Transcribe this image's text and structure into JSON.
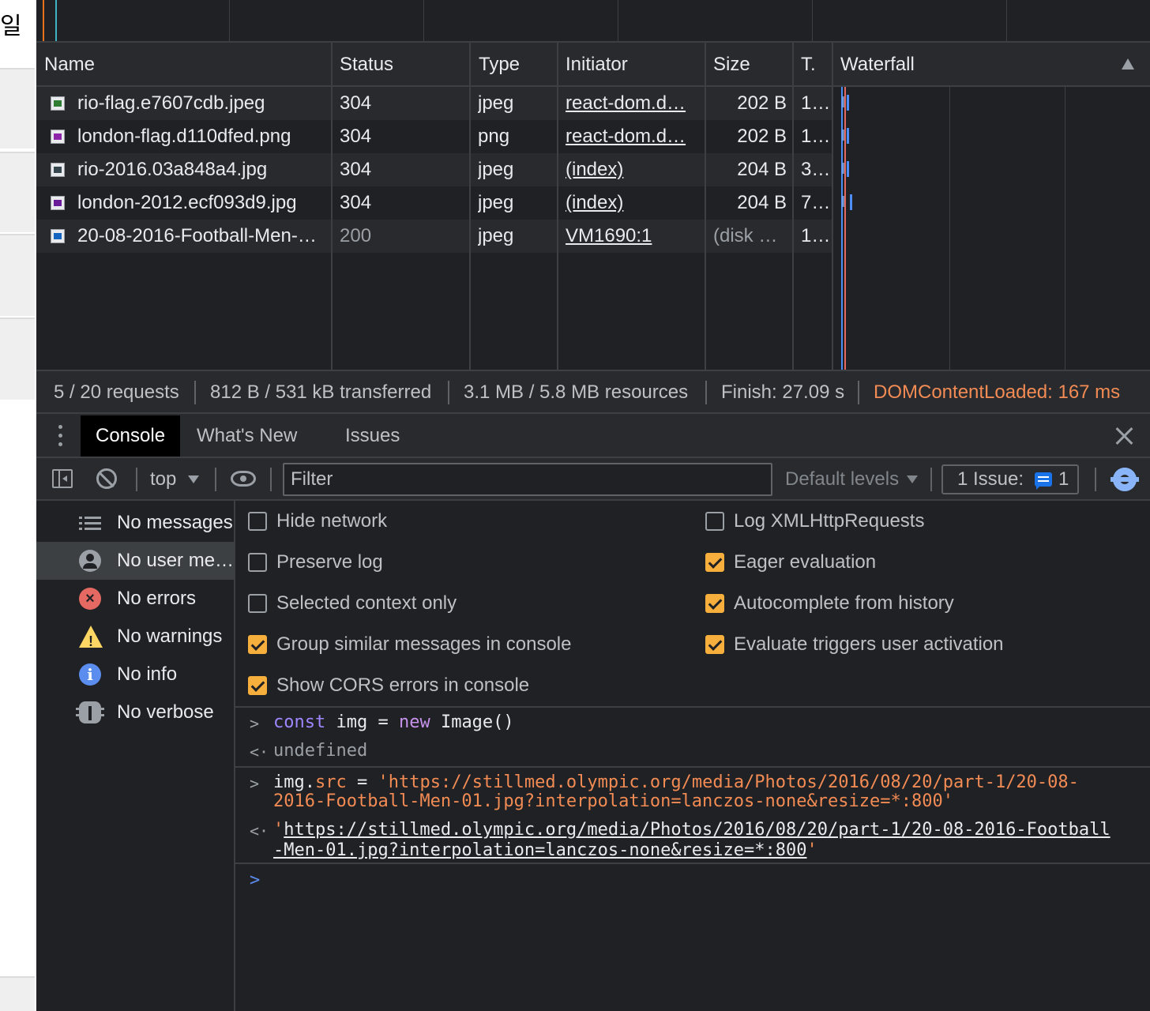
{
  "page": {
    "side_glyph": "일"
  },
  "network": {
    "columns": {
      "name": "Name",
      "status": "Status",
      "type": "Type",
      "initiator": "Initiator",
      "size": "Size",
      "time": "T.",
      "waterfall": "Waterfall"
    },
    "rows": [
      {
        "name": "rio-flag.e7607cdb.jpeg",
        "status": "304",
        "type": "jpeg",
        "initiator": "react-dom.d…",
        "size": "202 B",
        "time": "1…"
      },
      {
        "name": "london-flag.d110dfed.png",
        "status": "304",
        "type": "png",
        "initiator": "react-dom.d…",
        "size": "202 B",
        "time": "1…"
      },
      {
        "name": "rio-2016.03a848a4.jpg",
        "status": "304",
        "type": "jpeg",
        "initiator": "(index)",
        "size": "204 B",
        "time": "3…"
      },
      {
        "name": "london-2012.ecf093d9.jpg",
        "status": "304",
        "type": "jpeg",
        "initiator": "(index)",
        "size": "204 B",
        "time": "7…"
      },
      {
        "name": "20-08-2016-Football-Men-…",
        "status": "200",
        "type": "jpeg",
        "initiator": "VM1690:1",
        "size": "(disk …",
        "time": "1…"
      }
    ],
    "summary": {
      "requests": "5 / 20 requests",
      "transferred": "812 B / 531 kB transferred",
      "resources": "3.1 MB / 5.8 MB resources",
      "finish": "Finish: 27.09 s",
      "dcl": "DOMContentLoaded: 167 ms"
    }
  },
  "drawer": {
    "tabs": [
      "Console",
      "What's New",
      "Issues"
    ]
  },
  "toolbar": {
    "context": "top",
    "filter_placeholder": "Filter",
    "levels": "Default levels",
    "issues_label": "1 Issue:",
    "issues_count": "1"
  },
  "sidebar": {
    "items": [
      {
        "label": "No messages",
        "icon": "list-icon"
      },
      {
        "label": "No user me…",
        "icon": "user-icon"
      },
      {
        "label": "No errors",
        "icon": "error-icon"
      },
      {
        "label": "No warnings",
        "icon": "warning-icon"
      },
      {
        "label": "No info",
        "icon": "info-icon"
      },
      {
        "label": "No verbose",
        "icon": "bug-icon"
      }
    ]
  },
  "settings": {
    "left": [
      {
        "label": "Hide network",
        "checked": false
      },
      {
        "label": "Preserve log",
        "checked": false
      },
      {
        "label": "Selected context only",
        "checked": false
      },
      {
        "label": "Group similar messages in console",
        "checked": true
      },
      {
        "label": "Show CORS errors in console",
        "checked": true
      }
    ],
    "right": [
      {
        "label": "Log XMLHttpRequests",
        "checked": false
      },
      {
        "label": "Eager evaluation",
        "checked": true
      },
      {
        "label": "Autocomplete from history",
        "checked": true
      },
      {
        "label": "Evaluate triggers user activation",
        "checked": true
      }
    ]
  },
  "console": {
    "line1": {
      "kw": "const",
      "rest": " img = ",
      "kw2": "new",
      "rest2": " Image()"
    },
    "result1": "undefined",
    "line2": {
      "obj": "img.",
      "prop": "src",
      "eq": " = ",
      "str1": "'https://stillmed.olympic.org/media/Photos/2016/08/20/part-1/20-08-",
      "str2": "2016-Football-Men-01.jpg?interpolation=lanczos-none&resize=*:800'"
    },
    "result2": {
      "q": "'",
      "link1": "https://stillmed.olympic.org/media/Photos/2016/08/20/part-1/20-08-2016-Football",
      "link2": "-Men-01.jpg?interpolation=lanczos-none&resize=*:800"
    }
  },
  "colors": {
    "accent": "#8ab4f8",
    "checkbox": "#f6ae3c",
    "dcl": "#f28b54",
    "error": "#e46962",
    "warning": "#fdd663",
    "info": "#5b8def"
  }
}
